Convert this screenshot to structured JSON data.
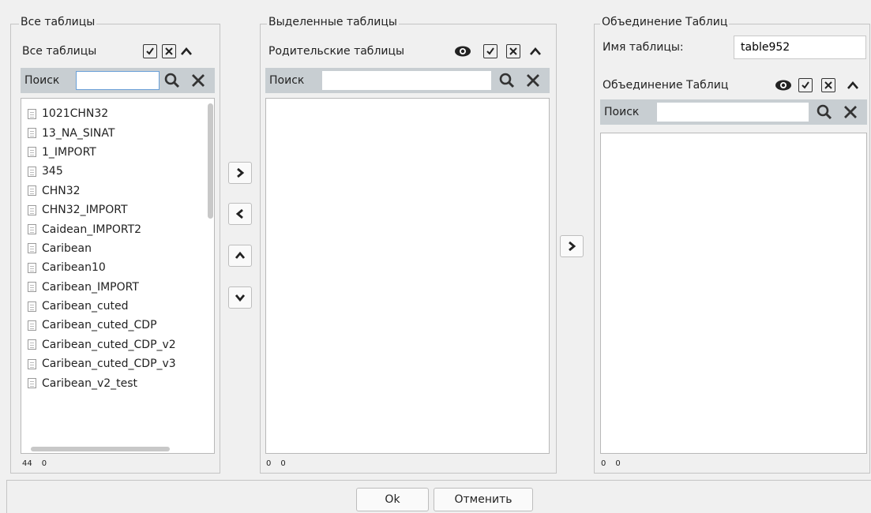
{
  "panels": {
    "all": {
      "group_title": "Все таблицы",
      "header_label": "Все таблицы",
      "search_label": "Поиск",
      "search_value": "",
      "items": [
        "1021CHN32",
        "13_NA_SINAT",
        "1_IMPORT",
        "345",
        "CHN32",
        "CHN32_IMPORT",
        "Caidean_IMPORT2",
        "Caribean",
        "Caribean10",
        "Caribean_IMPORT",
        "Caribean_cuted",
        "Caribean_cuted_CDP",
        "Caribean_cuted_CDP_v2",
        "Caribean_cuted_CDP_v3",
        "Caribean_v2_test"
      ],
      "count_total": "44",
      "count_selected": "0"
    },
    "selected": {
      "group_title": "Выделенные таблицы",
      "header_label": "Родительские таблицы",
      "search_label": "Поиск",
      "search_value": "",
      "count_total": "0",
      "count_selected": "0"
    },
    "union": {
      "group_title": "Объединение Таблиц",
      "name_label": "Имя таблицы:",
      "name_value": "table952",
      "header_label": "Объединение Таблиц",
      "search_label": "Поиск",
      "search_value": "",
      "count_total": "0",
      "count_selected": "0"
    }
  },
  "footer": {
    "ok_label": "Ok",
    "cancel_label": "Отменить"
  },
  "icons": {
    "check_all": "check-all-icon",
    "uncheck_all": "uncheck-all-icon",
    "collapse": "chevron-up-icon",
    "eye": "eye-icon",
    "search": "search-icon",
    "clear": "close-icon",
    "move_right": "chevron-right-icon",
    "move_left": "chevron-left-icon",
    "move_up": "chevron-up-icon",
    "move_down": "chevron-down-icon",
    "list_item": "document-icon"
  }
}
